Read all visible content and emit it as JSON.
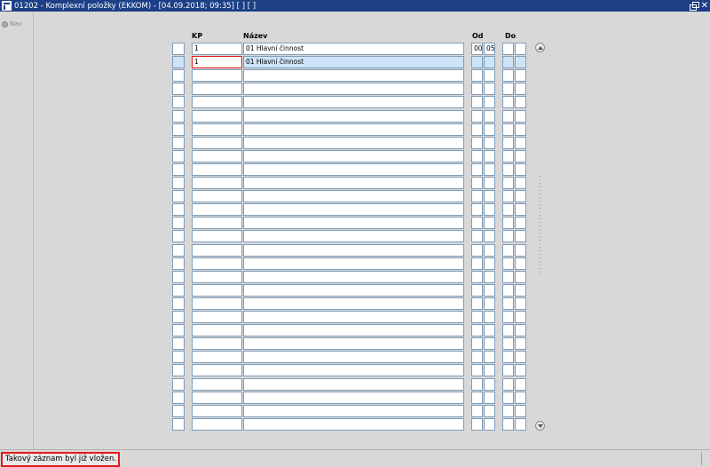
{
  "window": {
    "title": "01202 - Komplexní položky (EKKOM) - [04.09.2018; 09:35]  [ ]  [ ]",
    "close_glyph": "✕"
  },
  "nav": {
    "label": "Nav"
  },
  "columns": {
    "kp": "KP",
    "name": "Název",
    "od": "Od",
    "do": "Do"
  },
  "rows": [
    {
      "kp": "1",
      "name": "01 Hlavní činnost",
      "od1": "00",
      "od2": "05",
      "do1": "",
      "do2": ""
    },
    {
      "kp": "1",
      "name": "01 Hlavní činnost",
      "od1": "",
      "od2": "",
      "do1": "",
      "do2": ""
    }
  ],
  "empty_row_count": 27,
  "selected_row": 1,
  "status": {
    "message": "Takový záznam byl již vložen."
  },
  "colors": {
    "titlebar": "#1c3f86",
    "selection": "#cde4f7",
    "error_outline": "#e21b1b"
  }
}
